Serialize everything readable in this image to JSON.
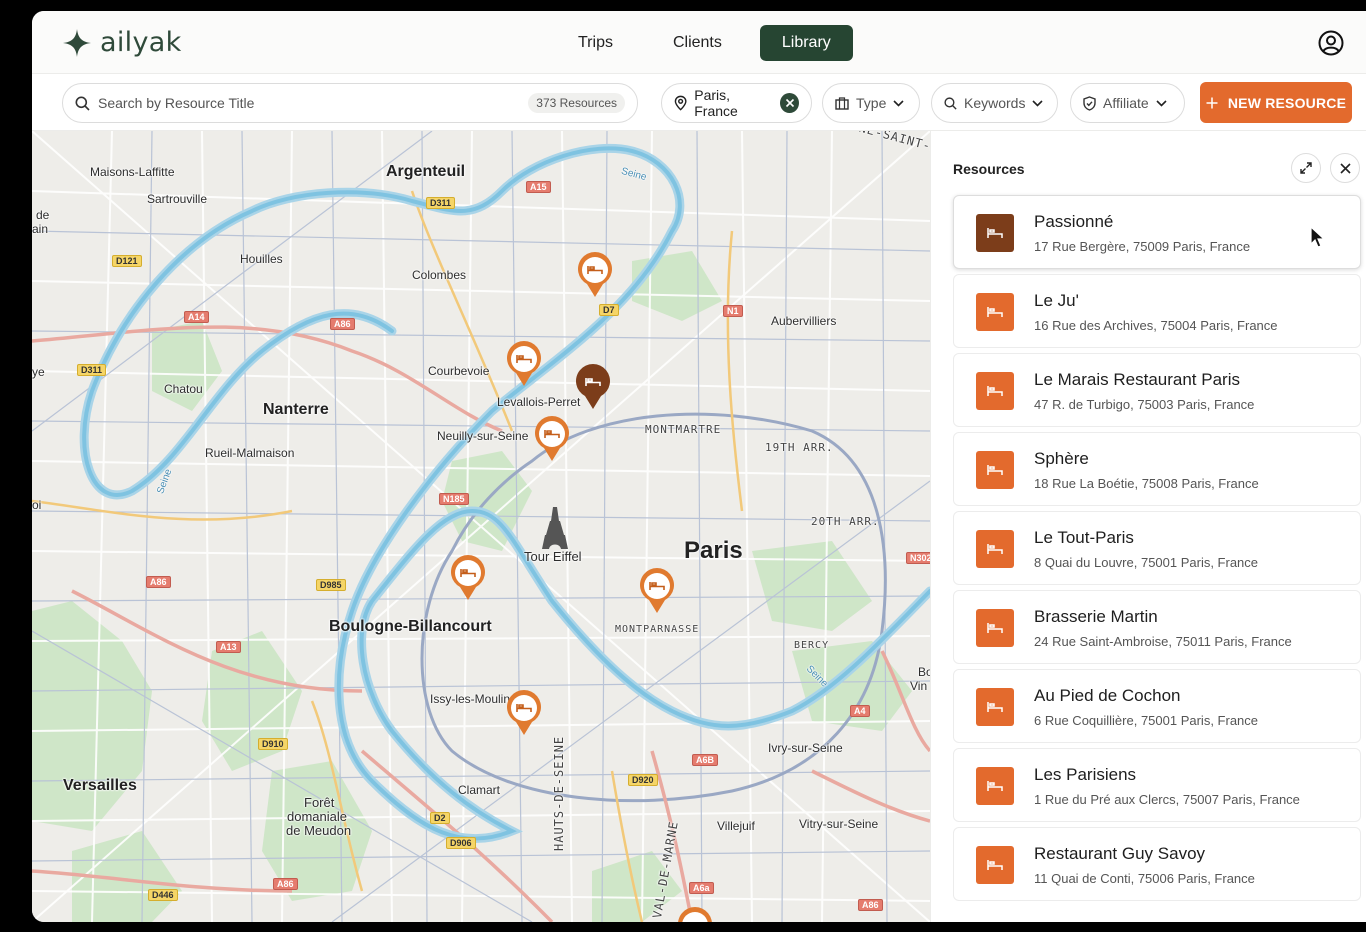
{
  "brand": {
    "name": "ailyak",
    "accent": "#e36a2d",
    "dark_green": "#264532"
  },
  "nav": {
    "items": [
      "Trips",
      "Clients",
      "Library"
    ],
    "active": "Library"
  },
  "toolbar": {
    "search_placeholder": "Search by Resource Title",
    "resource_count": "373 Resources",
    "location_filter": "Paris, France",
    "type_filter": "Type",
    "keywords_filter": "Keywords",
    "affiliate_filter": "Affiliate",
    "new_resource_label": "NEW RESOURCE"
  },
  "map": {
    "labels": {
      "argenteuil": "Argenteuil",
      "maisons": "Maisons-Laffitte",
      "sartrouville": "Sartrouville",
      "houilles": "Houilles",
      "colombes": "Colombes",
      "aubervilliers": "Aubervilliers",
      "chatou": "Chatou",
      "nanterre": "Nanterre",
      "courbevoie": "Courbevoie",
      "levallois": "Levallois-Perret",
      "neuilly": "Neuilly-sur-Seine",
      "rueil": "Rueil-Malmaison",
      "montmartre": "MONTMARTRE",
      "arr19": "19TH ARR.",
      "arr20": "20TH ARR.",
      "paris": "Paris",
      "eiffel": "Tour Eiffel",
      "boulogne": "Boulogne-Billancourt",
      "montparnasse": "MONTPARNASSE",
      "bercy": "BERCY",
      "issy": "Issy-les-Moulin",
      "ivry": "Ivry-sur-Seine",
      "versailles": "Versailles",
      "clamart": "Clamart",
      "foret1": "Forêt",
      "foret2": "domaniale",
      "foret3": "de Meudon",
      "villejuif": "Villejuif",
      "vitry": "Vitry-sur-Seine",
      "hauts": "HAUTS-DE-SEINE",
      "valmarne": "VAL-DE-MARNE",
      "seine_top": "Seine",
      "seine_left": "Seine",
      "seine_right": "Seine",
      "stdenis": "NE-SAINT-D",
      "edge_de": "de",
      "edge_ain": "ain",
      "edge_ye": "ye",
      "edge_oi": "oi",
      "edge_bo": "Bo",
      "edge_vin": "Vin"
    },
    "roads": {
      "a15": "A15",
      "d311a": "D311",
      "d121": "D121",
      "a14": "A14",
      "a86a": "A86",
      "d311b": "D311",
      "d7": "D7",
      "n1": "N1",
      "n185": "N185",
      "a86b": "A86",
      "d985": "D985",
      "a13": "A13",
      "n302": "N302",
      "a4": "A4",
      "d910": "D910",
      "a6b": "A6B",
      "d920": "D920",
      "d2": "D2",
      "d906": "D906",
      "a86c": "A86",
      "d446": "D446",
      "a6a": "A6a",
      "a86d": "A86"
    }
  },
  "panel": {
    "title": "Resources",
    "resources": [
      {
        "name": "Passionné",
        "address": "17 Rue Bergère, 75009 Paris, France"
      },
      {
        "name": "Le Ju'",
        "address": "16 Rue des Archives, 75004 Paris, France"
      },
      {
        "name": "Le Marais Restaurant Paris",
        "address": "47 R. de Turbigo, 75003 Paris, France"
      },
      {
        "name": "Sphère",
        "address": "18 Rue La Boétie, 75008 Paris, France"
      },
      {
        "name": "Le Tout-Paris",
        "address": "8 Quai du Louvre, 75001 Paris, France"
      },
      {
        "name": "Brasserie Martin",
        "address": "24 Rue Saint-Ambroise, 75011 Paris, France"
      },
      {
        "name": "Au Pied de Cochon",
        "address": "6 Rue Coquillière, 75001 Paris, France"
      },
      {
        "name": "Les Parisiens",
        "address": "1 Rue du Pré aux Clercs, 75007 Paris, France"
      },
      {
        "name": "Restaurant Guy Savoy",
        "address": "11 Quai de Conti, 75006 Paris, France"
      }
    ]
  }
}
